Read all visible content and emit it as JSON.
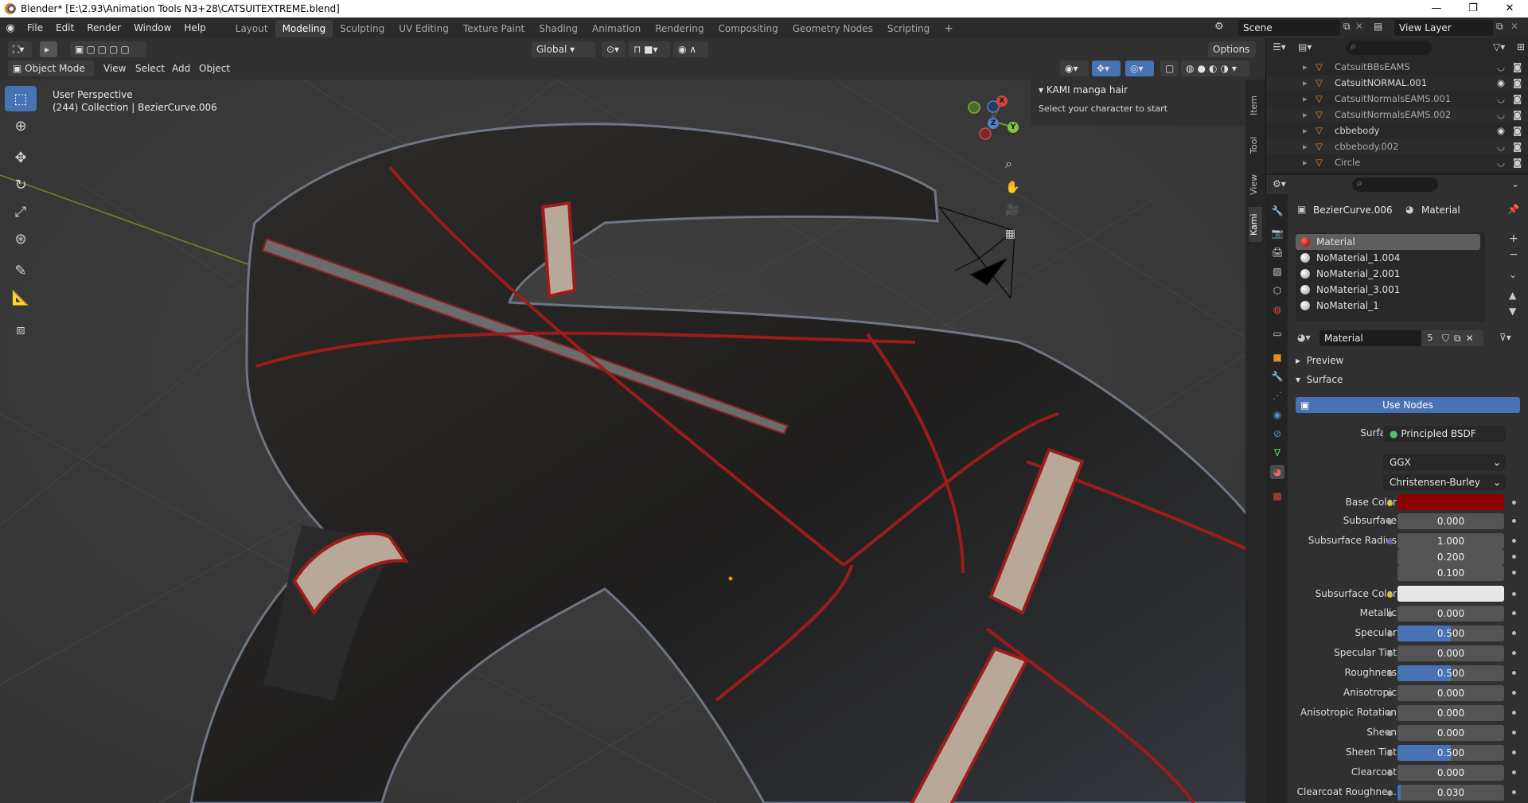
{
  "window": {
    "title": "Blender* [E:\\2.93\\Animation Tools N3+28\\CATSUITEXTREME.blend]",
    "minimize": "—",
    "maximize": "❐",
    "close": "✕"
  },
  "menu": [
    "File",
    "Edit",
    "Render",
    "Window",
    "Help"
  ],
  "workspaces": [
    "Layout",
    "Modeling",
    "Sculpting",
    "UV Editing",
    "Texture Paint",
    "Shading",
    "Animation",
    "Rendering",
    "Compositing",
    "Geometry Nodes",
    "Scripting"
  ],
  "active_workspace": "Modeling",
  "scene": {
    "name": "Scene",
    "view_layer": "View Layer"
  },
  "viewport_header": {
    "transform_orientation": "Global",
    "options": "Options",
    "mode": "Object Mode",
    "menus": [
      "View",
      "Select",
      "Add",
      "Object"
    ]
  },
  "viewport": {
    "perspective": "User Perspective",
    "collection": "(244) Collection | BezierCurve.006",
    "gizmo": {
      "x": "X",
      "y": "Y",
      "z": "Z"
    }
  },
  "npanel": {
    "panel_title": "KAMI manga hair",
    "message": "Select your character to start",
    "tabs": [
      "Item",
      "Tool",
      "View",
      "Kami"
    ]
  },
  "outliner": {
    "items": [
      {
        "name": "CatsuitBBsEAMS",
        "visible": false
      },
      {
        "name": "CatsuitNORMAL.001",
        "visible": true
      },
      {
        "name": "CatsuitNormalsEAMS.001",
        "visible": false
      },
      {
        "name": "CatsuitNormalsEAMS.002",
        "visible": false
      },
      {
        "name": "cbbebody",
        "visible": true
      },
      {
        "name": "cbbebody.002",
        "visible": false
      },
      {
        "name": "Circle",
        "visible": false
      }
    ]
  },
  "properties": {
    "object": "BezierCurve.006",
    "context": "Material",
    "slots": [
      "Material",
      "NoMaterial_1.004",
      "NoMaterial_2.001",
      "NoMaterial_3.001",
      "NoMaterial_1"
    ],
    "active_material": "Material",
    "users": "5",
    "panels": {
      "preview": "Preview",
      "surface": "Surface"
    },
    "use_nodes": "Use Nodes",
    "surface_label": "Surface",
    "surface_shader": "Principled BSDF",
    "distribution": "GGX",
    "subsurface_method": "Christensen-Burley",
    "base_color": "#8b0000",
    "subsurface_color": "#e8e8e8",
    "fields": [
      {
        "label": "Subsurface",
        "value": "0.000",
        "fill": 0.0
      },
      {
        "label": "Subsurface Radius",
        "value": "1.000",
        "fill": 0.0
      },
      {
        "label": "",
        "value": "0.200",
        "fill": 0.0
      },
      {
        "label": "",
        "value": "0.100",
        "fill": 0.0
      },
      {
        "label": "Metallic",
        "value": "0.000",
        "fill": 0.0
      },
      {
        "label": "Specular",
        "value": "0.500",
        "fill": 0.5
      },
      {
        "label": "Specular Tint",
        "value": "0.000",
        "fill": 0.0
      },
      {
        "label": "Roughness",
        "value": "0.500",
        "fill": 0.5
      },
      {
        "label": "Anisotropic",
        "value": "0.000",
        "fill": 0.0
      },
      {
        "label": "Anisotropic Rotation",
        "value": "0.000",
        "fill": 0.0
      },
      {
        "label": "Sheen",
        "value": "0.000",
        "fill": 0.0
      },
      {
        "label": "Sheen Tint",
        "value": "0.500",
        "fill": 0.5
      },
      {
        "label": "Clearcoat",
        "value": "0.000",
        "fill": 0.0
      },
      {
        "label": "Clearcoat Roughne...",
        "value": "0.030",
        "fill": 0.03
      }
    ],
    "labels": {
      "base_color": "Base Color",
      "subsurface_color": "Subsurface Color"
    }
  }
}
